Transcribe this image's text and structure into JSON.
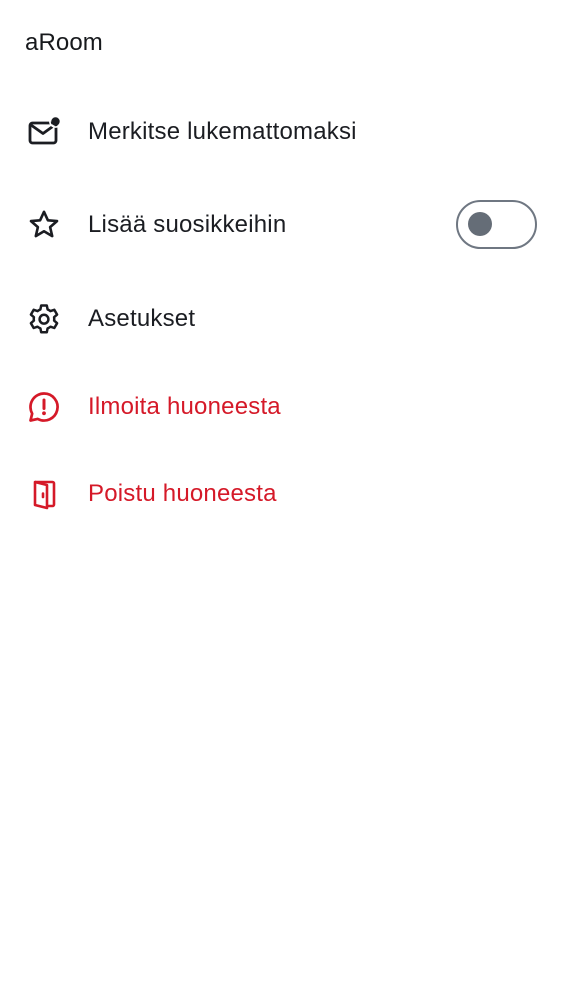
{
  "room": {
    "title": "aRoom"
  },
  "menu": {
    "mark_unread": {
      "label": "Merkitse lukemattomaksi",
      "icon": "mail-unread-icon"
    },
    "favourite": {
      "label": "Lisää suosikkeihin",
      "icon": "star-outline-icon",
      "toggle_on": false
    },
    "settings": {
      "label": "Asetukset",
      "icon": "gear-icon"
    },
    "report": {
      "label": "Ilmoita huoneesta",
      "icon": "chat-alert-icon"
    },
    "leave": {
      "label": "Poistu huoneesta",
      "icon": "door-leave-icon"
    }
  },
  "colors": {
    "text": "#1b1d22",
    "danger": "#d51928",
    "toggle_border": "#6f7782",
    "toggle_knob": "#656d77",
    "background": "#ffffff"
  }
}
